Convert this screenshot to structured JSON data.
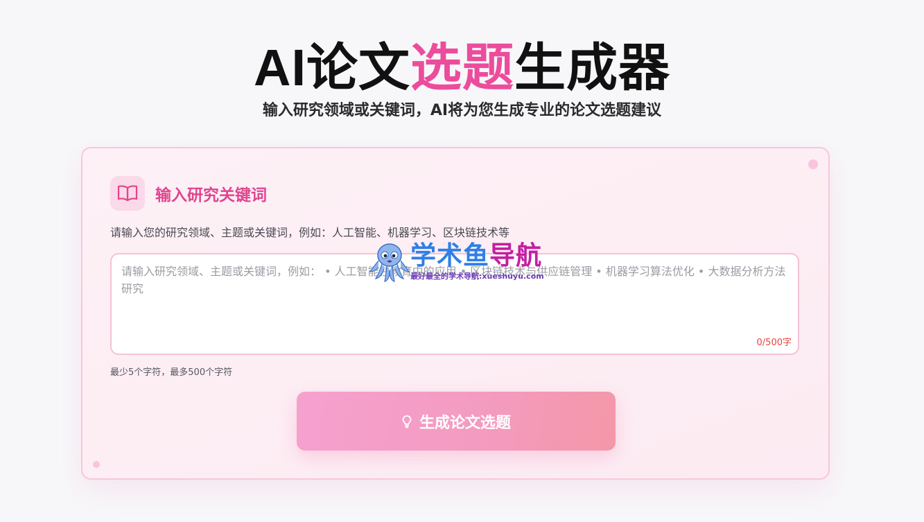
{
  "hero": {
    "title_part1": "AI论文",
    "title_accent": "选题",
    "title_part2": "生成器",
    "subtitle": "输入研究领域或关键词，AI将为您生成专业的论文选题建议"
  },
  "form": {
    "section_icon": "open-book-icon",
    "section_title": "输入研究关键词",
    "helper": "请输入您的研究领域、主题或关键词，例如：人工智能、机器学习、区块链技术等",
    "textarea_value": "",
    "textarea_placeholder": "请输入研究领域、主题或关键词，例如： • 人工智能在教育中的应用 • 区块链技术与供应链管理 • 机器学习算法优化 • 大数据分析方法研究",
    "char_counter": "0/500字",
    "limit_note": "最少5个字符，最多500个字符",
    "submit_icon": "lightbulb-icon",
    "submit_label": "生成论文选题"
  },
  "watermark": {
    "brand_part1": "学术鱼",
    "brand_part2": "导航",
    "tagline": "最好最全的学术导航:xueshuyu.com"
  },
  "colors": {
    "accent": "#ec4c9c",
    "card_border": "#f8c6dc",
    "counter": "#e0463f",
    "button_start": "#f5a1cf",
    "button_end": "#f497a8"
  }
}
